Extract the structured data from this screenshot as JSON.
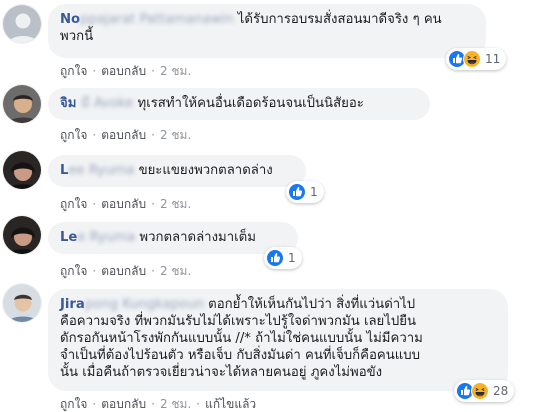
{
  "comments": [
    {
      "author_visible": "No",
      "author_blurred": "ppajarat Pattamanawin",
      "text": "ได้รับการอบรมสั่งสอนมาดีจริง ๆ คนพวกนี้",
      "text_line1": "ได้รับการอบรมสั่งสอนมาดีจริง ๆ คน",
      "text_line2": "พวกนี้",
      "like": "ถูกใจ",
      "reply": "ตอบกลับ",
      "time": "2 ชม.",
      "reaction_count": "11",
      "reactions": [
        "like-icon",
        "haha-icon"
      ]
    },
    {
      "author_visible": "จิม",
      "author_blurred": "มี Avoke",
      "text": "ทุเรสทำให้คนอื่นเดือดร้อนจนเป็นนิสัยอะ",
      "like": "ถูกใจ",
      "reply": "ตอบกลับ",
      "time": "2 ชม."
    },
    {
      "author_visible": "L",
      "author_blurred": "ee Ryuma",
      "text": "ขยะแขยงพวกตลาดล่าง",
      "like": "ถูกใจ",
      "reply": "ตอบกลับ",
      "time": "2 ชม.",
      "reaction_count": "1",
      "reactions": [
        "like-icon"
      ]
    },
    {
      "author_visible": "Le",
      "author_blurred": "e Ryuma",
      "text": "พวกตลาดล่างมาเต็ม",
      "like": "ถูกใจ",
      "reply": "ตอบกลับ",
      "time": "2 ชม.",
      "reaction_count": "1",
      "reactions": [
        "like-icon"
      ]
    },
    {
      "author_visible": "Jira",
      "author_blurred": "pong Kungkapoun",
      "text_line1_rest": "ตอกย้ำให้เห็นกันไปว่า สิ่งที่แว่นด่าไป",
      "text_line2": "คือความจริง ที่พวกมันรับไม่ได้เพราะไปรู้ใจด่าพวกมัน เลยไปยืน",
      "text_line3": "ดักรอกันหน้าโรงพักกันแบบนั้น //* ถ้าไม่ใช่คนแบบนั้น ไม่มีความ",
      "text_line4": "จำเป็นที่ต้องไปร้อนตัว หรือเจ็บ กับสิ่งมันด่า คนที่เจ็บก็คือคนแบบ",
      "text_line5": "นั้น เมื่อคืนถ้าตรวจเยี่ยวน่าจะได้หลายคนอยู่ ภูคงไม่พอขัง",
      "like": "ถูกใจ",
      "reply": "ตอบกลับ",
      "time": "2 ชม.",
      "edited": "แก้ไขแล้ว",
      "reaction_count": "28",
      "reactions": [
        "like-icon",
        "haha-icon"
      ]
    }
  ],
  "colors": {
    "author": "#385898",
    "bubble": "#f2f3f5",
    "like_blue": "#1877f2",
    "haha_yellow": "#f7b125",
    "meta": "#90949c"
  }
}
